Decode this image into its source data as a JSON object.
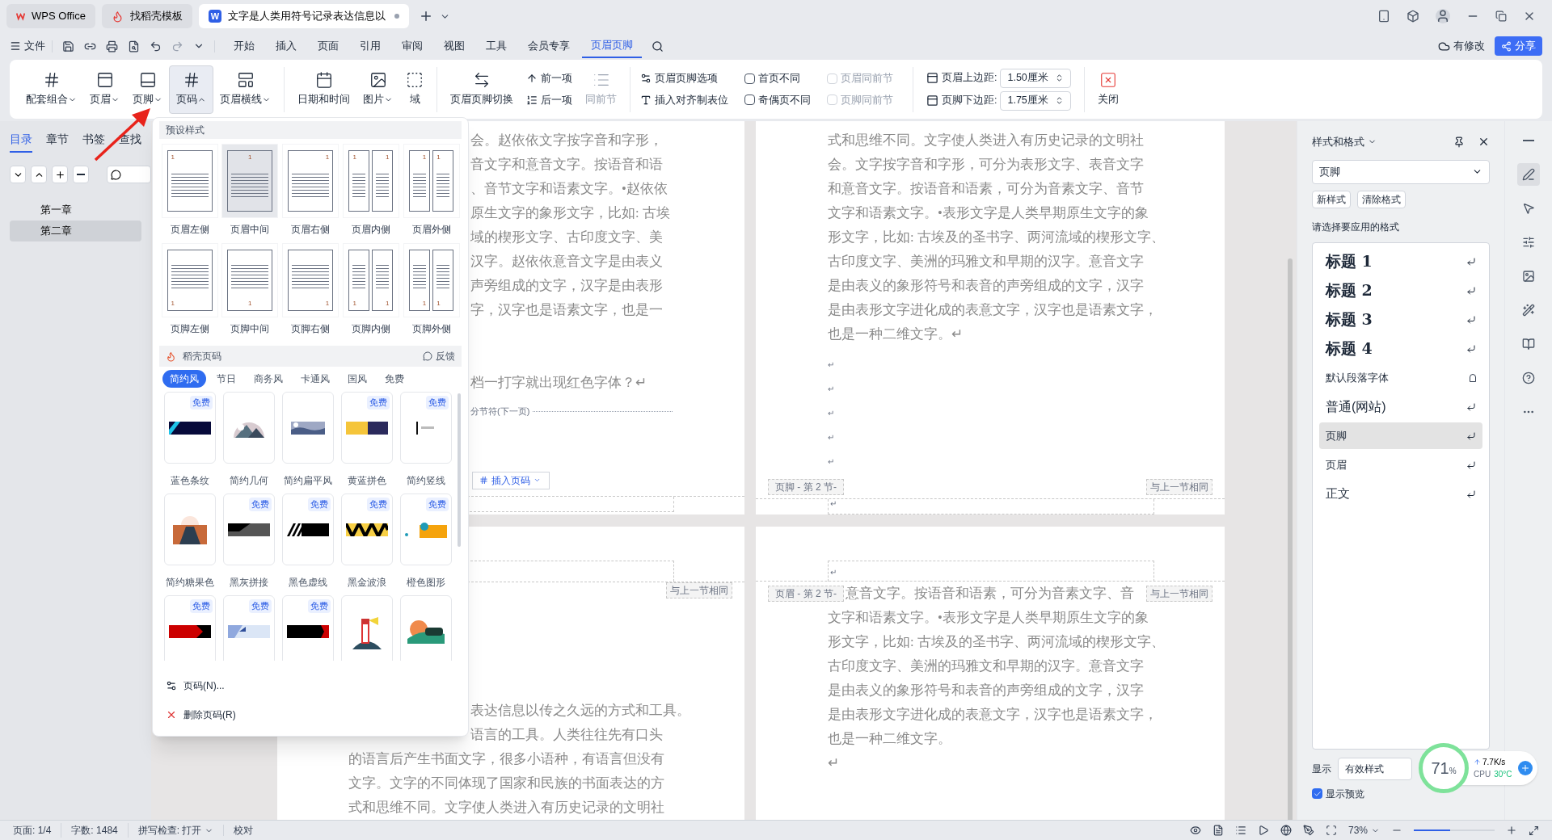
{
  "tabs": [
    {
      "label": "WPS Office",
      "kind": "home",
      "selected": false
    },
    {
      "label": "找稻壳模板",
      "kind": "template",
      "selected": false
    },
    {
      "label": "文字是人类用符号记录表达信息以",
      "kind": "doc",
      "logo": "W",
      "selected": true
    }
  ],
  "menu": {
    "file": "文件",
    "items": [
      {
        "label": "开始",
        "selected": false
      },
      {
        "label": "插入",
        "selected": false
      },
      {
        "label": "页面",
        "selected": false
      },
      {
        "label": "引用",
        "selected": false
      },
      {
        "label": "审阅",
        "selected": false
      },
      {
        "label": "视图",
        "selected": false
      },
      {
        "label": "工具",
        "selected": false
      },
      {
        "label": "会员专享",
        "selected": false
      },
      {
        "label": "页眉页脚",
        "selected": true
      }
    ],
    "status": "有修改",
    "share": "分享"
  },
  "ribbon": {
    "insert_group": [
      {
        "label": "配套组合",
        "kind": "combo",
        "open": false
      },
      {
        "label": "页眉",
        "kind": "header",
        "open": false
      },
      {
        "label": "页脚",
        "kind": "footer",
        "open": false
      },
      {
        "label": "页码",
        "kind": "number",
        "open": true
      },
      {
        "label": "页眉横线",
        "kind": "rule",
        "open": false
      }
    ],
    "insert_items": [
      {
        "label": "日期和时间",
        "kind": "date",
        "menu": false
      },
      {
        "label": "图片",
        "kind": "picture",
        "menu": true
      },
      {
        "label": "域",
        "kind": "field",
        "menu": false
      }
    ],
    "switch": "页眉页脚切换",
    "nav": [
      {
        "label": "前一项",
        "kind": "prev"
      },
      {
        "label": "后一项",
        "kind": "next"
      }
    ],
    "same_as_previous": {
      "label": "同前节",
      "disabled": true
    },
    "options": "页眉页脚选项",
    "tab_stop": "插入对齐制表位",
    "checkboxes": [
      {
        "label": "首页不同",
        "checked": false,
        "disabled": false
      },
      {
        "label": "奇偶页不同",
        "checked": false,
        "disabled": false
      },
      {
        "label": "页眉同前节",
        "checked": false,
        "disabled": true
      },
      {
        "label": "页脚同前节",
        "checked": false,
        "disabled": true
      }
    ],
    "margins": [
      {
        "label": "页眉上边距:",
        "value": "1.50厘米"
      },
      {
        "label": "页脚下边距:",
        "value": "1.75厘米"
      }
    ],
    "close": "关闭"
  },
  "left_panel": {
    "tabs": [
      {
        "label": "目录",
        "selected": true
      },
      {
        "label": "章节",
        "selected": false
      },
      {
        "label": "书签",
        "selected": false
      },
      {
        "label": "查找",
        "selected": false
      }
    ],
    "outline": [
      {
        "label": "第一章",
        "selected": false
      },
      {
        "label": "第二章",
        "selected": true
      }
    ]
  },
  "document": {
    "top_left": {
      "lines": [
        "会。赵依依文字按字音和字形，",
        "音文字和意音文字。按语音和语",
        "、音节文字和语素文字。•赵依依",
        "原生文字的象形文字，比如: 古埃",
        "域的楔形文字、古印度文字、美",
        "汉字。赵依依意音文字是由表义",
        "声旁组成的文字，汉字是由表形",
        "字，汉字也是语素文字，也是一"
      ],
      "question": "档一打字就出现红色字体？↵",
      "section_break": "分节符(下一页)",
      "insert_page_number": "插入页码"
    },
    "top_right": {
      "lines": [
        "式和思维不同。文字使人类进入有历史记录的文明社",
        "会。文字按字音和字形，可分为表形文字、表音文字",
        "和意音文字。按语音和语素，可分为音素文字、音节",
        "文字和语素文字。•表形文字是人类早期原生文字的象",
        "形文字，比如: 古埃及的圣书字、两河流域的楔形文字、",
        "古印度文字、美洲的玛雅文和早期的汉字。意音文字",
        "是由表义的象形符号和表音的声旁组成的文字，汉字",
        "是由表形文字进化成的表意文字，汉字也是语素文字，",
        "也是一种二维文字。↵"
      ],
      "marks": [
        "↵",
        "↵",
        "↵",
        "↵",
        "↵"
      ],
      "footer_label": "页脚 - 第 2 节-",
      "same_label": "与上一节相同",
      "footer_mark": "↵"
    },
    "bottom_left": {
      "same_label": "与上一节相同",
      "partial_lines": [
        "表达信息以传之久远的方式和工具。",
        "语言的工具。人类往往先有口头"
      ],
      "lines": [
        "的语言后产生书面文字，很多小语种，有语言但没有",
        "文字。文字的不同体现了国家和民族的书面表达的方",
        "式和思维不同。文字使人类进入有历史记录的文明社"
      ]
    },
    "bottom_right": {
      "header_mark": "↵",
      "header_label": "页眉 - 第 2 节-",
      "same_label": "与上一节相同",
      "first_line": "意音文字。按语音和语素，可分为音素文字、音",
      "lines": [
        "文字和语素文字。•表形文字是人类早期原生文字的象",
        "形文字，比如: 古埃及的圣书字、两河流域的楔形文字、",
        "古印度文字、美洲的玛雅文和早期的汉字。意音文字",
        "是由表义的象形符号和表音的声旁组成的文字，汉字",
        "是由表形文字进化成的表意文字，汉字也是语素文字，",
        "也是一种二维文字。",
        "↵"
      ]
    }
  },
  "dropdown": {
    "preset_title": "预设样式",
    "presets": [
      {
        "label": "页眉左侧",
        "kind": "header",
        "selected": false,
        "pages": [
          {
            "number": "1",
            "kind": "left"
          }
        ]
      },
      {
        "label": "页眉中间",
        "kind": "header",
        "selected": true,
        "pages": [
          {
            "number": "1",
            "kind": "center"
          }
        ]
      },
      {
        "label": "页眉右侧",
        "kind": "header",
        "selected": false,
        "pages": [
          {
            "number": "1",
            "kind": "right"
          }
        ]
      },
      {
        "label": "页眉内侧",
        "kind": "header",
        "selected": false,
        "pages": [
          {
            "number": "1",
            "kind": "left"
          },
          {
            "number": "1",
            "kind": "right"
          }
        ]
      },
      {
        "label": "页眉外侧",
        "kind": "header",
        "selected": false,
        "pages": [
          {
            "number": "1",
            "kind": "right"
          },
          {
            "number": "1",
            "kind": "left"
          }
        ]
      },
      {
        "label": "页脚左侧",
        "kind": "footer",
        "selected": false,
        "pages": [
          {
            "number": "1",
            "kind": "left"
          }
        ]
      },
      {
        "label": "页脚中间",
        "kind": "footer",
        "selected": false,
        "pages": [
          {
            "number": "1",
            "kind": "center"
          }
        ]
      },
      {
        "label": "页脚右侧",
        "kind": "footer",
        "selected": false,
        "pages": [
          {
            "number": "1",
            "kind": "right"
          }
        ]
      },
      {
        "label": "页脚内侧",
        "kind": "footer",
        "selected": false,
        "pages": [
          {
            "number": "1",
            "kind": "left"
          },
          {
            "number": "1",
            "kind": "right"
          }
        ]
      },
      {
        "label": "页脚外侧",
        "kind": "footer",
        "selected": false,
        "pages": [
          {
            "number": "1",
            "kind": "right"
          },
          {
            "number": "1",
            "kind": "left"
          }
        ]
      }
    ],
    "store_title": "稻壳页码",
    "feedback": "反馈",
    "categories": [
      {
        "label": "简约风",
        "selected": true
      },
      {
        "label": "节日",
        "selected": false
      },
      {
        "label": "商务风",
        "selected": false
      },
      {
        "label": "卡通风",
        "selected": false
      },
      {
        "label": "国风",
        "selected": false
      },
      {
        "label": "免费",
        "selected": false
      }
    ],
    "templates": [
      {
        "label": "蓝色条纹",
        "kind": "stripe",
        "badge": "免费"
      },
      {
        "label": "简约几何",
        "kind": "mountain"
      },
      {
        "label": "简约扁平风",
        "kind": "landscape"
      },
      {
        "label": "黄蓝拼色",
        "kind": "split",
        "badge": "免费"
      },
      {
        "label": "简约竖线",
        "kind": "vline",
        "badge": "免费"
      },
      {
        "label": "简约糖果色",
        "kind": "road"
      },
      {
        "label": "黑灰拼接",
        "kind": "slant",
        "badge": "免费"
      },
      {
        "label": "黑色虚线",
        "kind": "dash",
        "badge": "免费"
      },
      {
        "label": "黑金波浪",
        "kind": "wave",
        "badge": "免费"
      },
      {
        "label": "橙色图形",
        "kind": "shape",
        "badge": "免费"
      },
      {
        "kind": "chevron",
        "badge": "免费"
      },
      {
        "kind": "tab",
        "badge": "免费"
      },
      {
        "kind": "notch",
        "badge": "免费"
      },
      {
        "kind": "lighthouse"
      },
      {
        "kind": "sunset"
      }
    ],
    "actions": [
      {
        "label": "页码(N)...",
        "kind": "settings"
      },
      {
        "label": "删除页码(R)",
        "kind": "delete"
      }
    ]
  },
  "styles_panel": {
    "title": "样式和格式",
    "current": "页脚",
    "new_style": "新样式",
    "clear": "清除格式",
    "prompt": "请选择要应用的格式",
    "styles": [
      {
        "label": "标题 1",
        "kind": "heading",
        "selected": false
      },
      {
        "label": "标题 2",
        "kind": "heading",
        "selected": false
      },
      {
        "label": "标题 3",
        "kind": "heading",
        "selected": false
      },
      {
        "label": "标题 4",
        "kind": "heading",
        "selected": false
      },
      {
        "label": "默认段落字体",
        "kind": "char",
        "selected": false
      },
      {
        "label": "普通(网站)",
        "kind": "web",
        "selected": false
      },
      {
        "label": "页脚",
        "kind": "plain",
        "selected": true
      },
      {
        "label": "页眉",
        "kind": "plain",
        "selected": false
      },
      {
        "label": "正文",
        "kind": "body",
        "selected": false
      }
    ],
    "show_label": "显示",
    "show_value": "有效样式",
    "preview": {
      "label": "显示预览",
      "checked": true
    }
  },
  "monitor": {
    "percent": "71",
    "unit": "%",
    "speed": "7.7K/s",
    "cpu": "CPU",
    "temp": "30°C"
  },
  "status_bar": {
    "page": "页面: 1/4",
    "words": "字数: 1484",
    "spell": "拼写检查: 打开",
    "proof": "校对",
    "zoom": "73%",
    "zoom_slider": {
      "level": 0.45
    }
  }
}
